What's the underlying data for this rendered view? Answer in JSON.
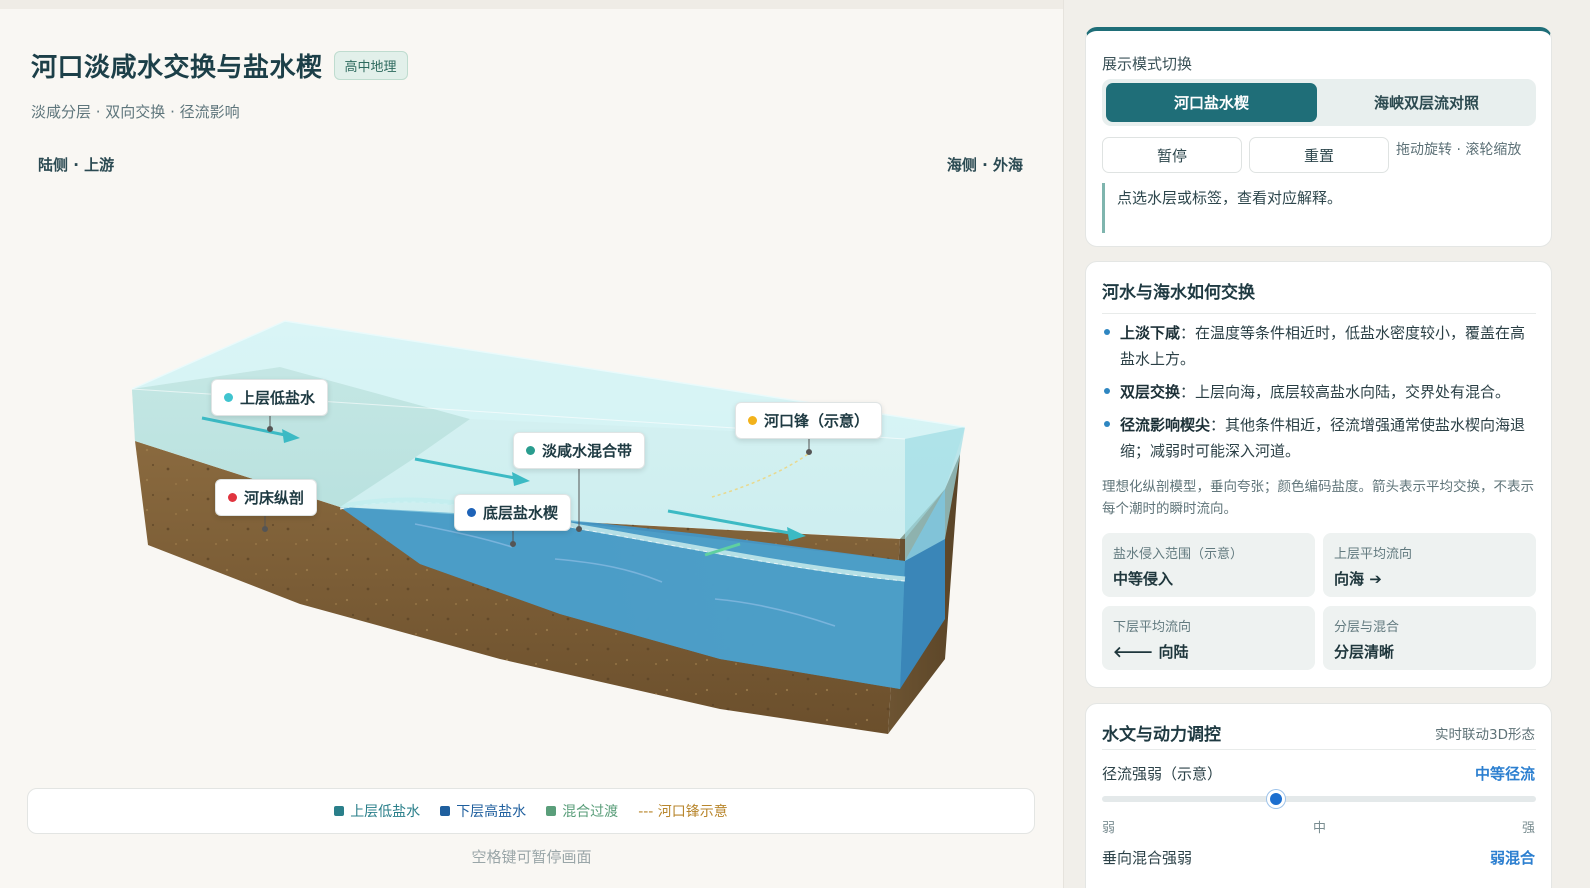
{
  "header": {
    "title": "河口淡咸水交换与盐水楔",
    "badge": "高中地理",
    "subtitle": "淡咸分层 · 双向交换 · 径流影响"
  },
  "scene": {
    "land_side": "陆侧 · 上游",
    "sea_side": "海侧 · 外海",
    "tags": {
      "upper": "上层低盐水",
      "mix": "淡咸水混合带",
      "front": "河口锋（示意）",
      "bed": "河床纵剖",
      "bottom": "底层盐水楔"
    },
    "colors": {
      "upper": "#40c4cf",
      "mix": "#2a9d8f",
      "front": "#f2b21b",
      "bed": "#e0343f",
      "bottom": "#1e63b8"
    }
  },
  "legend": {
    "items": [
      {
        "label": "上层低盐水",
        "color": "#2a7f8a"
      },
      {
        "label": "下层高盐水",
        "color": "#1f5f9e"
      },
      {
        "label": "混合过渡",
        "color": "#5a9e7a"
      },
      {
        "label": "--- 河口锋示意",
        "color": "#b8862c"
      }
    ]
  },
  "hint": "空格键可暂停画面",
  "panel": {
    "mode": {
      "title": "展示模式切换",
      "options": [
        "河口盐水楔",
        "海峡双层流对照"
      ],
      "active": "河口盐水楔"
    },
    "controls": {
      "pause": "暂停",
      "reset": "重置",
      "drag_hint": "拖动旋转 · 滚轮缩放"
    },
    "info": "点选水层或标签，查看对应解释。",
    "exchange": {
      "title": "河水与海水如何交换",
      "bullets": [
        {
          "term": "上淡下咸",
          "text": "：在温度等条件相近时，低盐水密度较小，覆盖在高盐水上方。"
        },
        {
          "term": "双层交换",
          "text": "：上层向海，底层较高盐水向陆，交界处有混合。"
        },
        {
          "term": "径流影响楔尖",
          "text": "：其他条件相近，径流增强通常使盐水楔向海退缩；减弱时可能深入河道。"
        }
      ],
      "note": "理想化纵剖模型，垂向夸张；颜色编码盐度。箭头表示平均交换，不表示每个潮时的瞬时流向。",
      "stats": [
        {
          "k": "盐水侵入范围（示意）",
          "v": "中等侵入"
        },
        {
          "k": "上层平均流向",
          "v": "向海 ➔"
        },
        {
          "k": "下层平均流向",
          "v": "🡐 向陆"
        },
        {
          "k": "分层与混合",
          "v": "分层清晰"
        }
      ]
    },
    "tuning": {
      "title": "水文与动力调控",
      "sub": "实时联动3D形态",
      "runoff_label": "径流强弱（示意）",
      "runoff_value": "中等径流",
      "runoff_level": 0.4,
      "ticks": [
        "弱",
        "中",
        "强"
      ],
      "mixing_label": "垂向混合强弱",
      "mixing_value": "弱混合"
    }
  }
}
